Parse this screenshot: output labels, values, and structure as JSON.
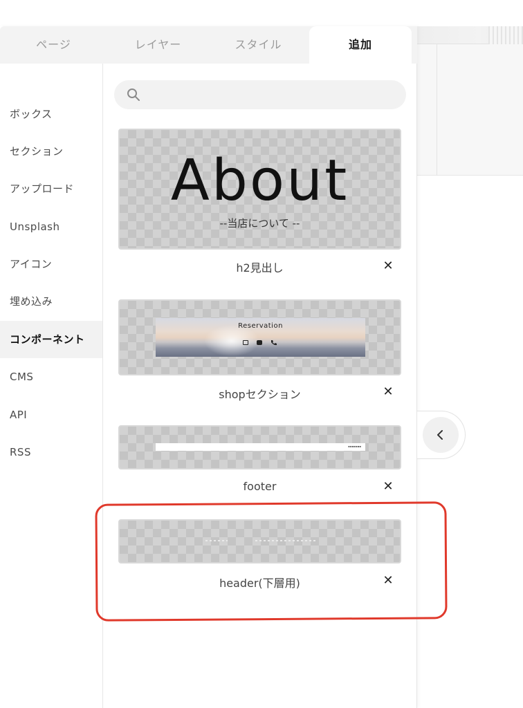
{
  "tabs": [
    {
      "label": "ページ",
      "active": false
    },
    {
      "label": "レイヤー",
      "active": false
    },
    {
      "label": "スタイル",
      "active": false
    },
    {
      "label": "追加",
      "active": true
    }
  ],
  "sidebar": {
    "items": [
      {
        "label": "ボックス"
      },
      {
        "label": "セクション"
      },
      {
        "label": "アップロード"
      },
      {
        "label": "Unsplash"
      },
      {
        "label": "アイコン"
      },
      {
        "label": "埋め込み"
      },
      {
        "label": "コンポーネント",
        "active": true
      },
      {
        "label": "CMS"
      },
      {
        "label": "API"
      },
      {
        "label": "RSS"
      }
    ]
  },
  "search": {
    "value": "",
    "placeholder": ""
  },
  "components": [
    {
      "name": "h2見出し",
      "preview_title": "About",
      "preview_subtitle": "--当店について --"
    },
    {
      "name": "shopセクション",
      "preview_title": "Reservation"
    },
    {
      "name": "footer"
    },
    {
      "name": "header(下層用)"
    }
  ],
  "close_symbol": "✕",
  "colors": {
    "annotation": "#e0392b",
    "accent_text": "#111111"
  }
}
